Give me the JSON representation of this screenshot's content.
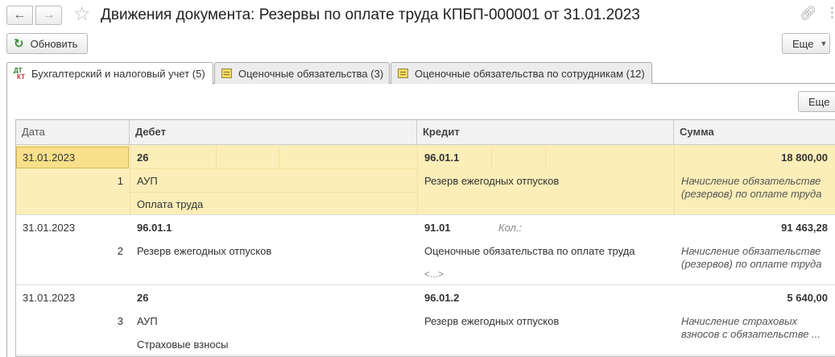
{
  "window": {
    "title": "Движения документа: Резервы по оплате труда КПБП-000001 от 31.01.2023"
  },
  "toolbar": {
    "refresh_label": "Обновить",
    "more_label": "Еще",
    "more_label_inner": "Еще"
  },
  "tabs": [
    {
      "label": "Бухгалтерский и налоговый учет (5)",
      "active": true,
      "icon": "dt-kt-icon"
    },
    {
      "label": "Оценочные обязательства (3)",
      "active": false,
      "icon": "register-icon"
    },
    {
      "label": "Оценочные обязательства по сотрудникам (12)",
      "active": false,
      "icon": "register-icon"
    }
  ],
  "tab_icon_text": {
    "dt": "ДТ",
    "kt": "КТ"
  },
  "grid": {
    "headers": {
      "date": "Дата",
      "debit": "Дебет",
      "credit": "Кредит",
      "sum": "Сумма"
    },
    "rows": [
      {
        "date": "31.01.2023",
        "num": "1",
        "debit_account": "26",
        "debit_sub1": "АУП",
        "debit_sub2": "Оплата труда",
        "credit_account": "96.01.1",
        "credit_sub1": "Резерв ежегодных отпусков",
        "amount": "18 800,00",
        "content_line1": "Начисление обязательстве",
        "content_line2": "(резервов) по оплате труда"
      },
      {
        "date": "31.01.2023",
        "num": "2",
        "debit_account": "96.01.1",
        "debit_sub1": "Резерв ежегодных отпусков",
        "credit_account": "91.01",
        "credit_qty_label": "Кол.:",
        "credit_sub1": "Оценочные обязательства по оплате труда",
        "credit_sub2": "<...>",
        "amount": "91 463,28",
        "content_line1": "Начисление обязательстве",
        "content_line2": "(резервов) по оплате труда"
      },
      {
        "date": "31.01.2023",
        "num": "3",
        "debit_account": "26",
        "debit_sub1": "АУП",
        "debit_sub2": "Страховые взносы",
        "credit_account": "96.01.2",
        "credit_sub1": "Резерв ежегодных отпусков",
        "amount": "5 640,00",
        "content_line1": "Начисление страховых",
        "content_line2": "взносов с обязательстве ..."
      }
    ]
  }
}
